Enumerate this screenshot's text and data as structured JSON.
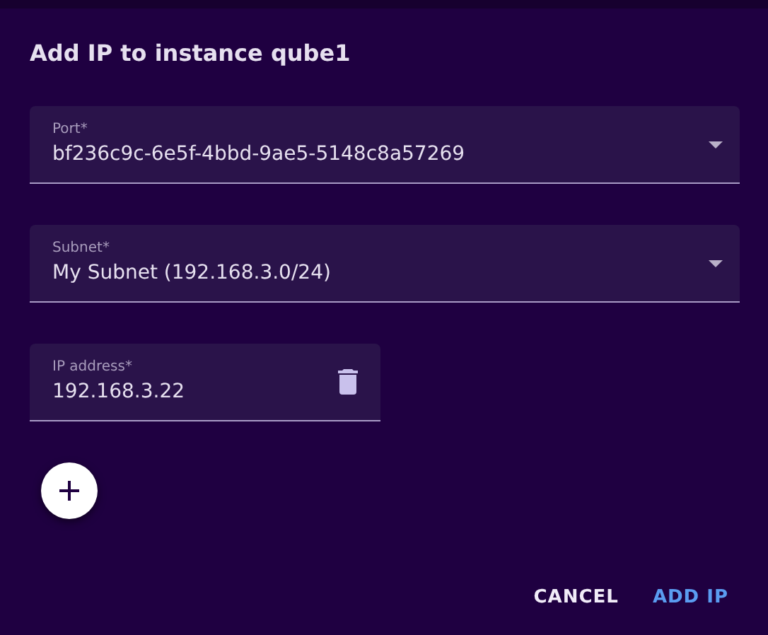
{
  "dialog": {
    "title": "Add IP to instance qube1",
    "fields": [
      {
        "kind": "select",
        "label": "Port*",
        "value": "bf236c9c-6e5f-4bbd-9ae5-5148c8a57269"
      },
      {
        "kind": "select",
        "label": "Subnet*",
        "value": "My Subnet (192.168.3.0/24)"
      },
      {
        "kind": "text",
        "label": "IP address*",
        "value": "192.168.3.22"
      }
    ],
    "buttons": [
      {
        "label": "CANCEL",
        "kind": "plain"
      },
      {
        "label": "ADD IP",
        "kind": "primary"
      }
    ]
  }
}
